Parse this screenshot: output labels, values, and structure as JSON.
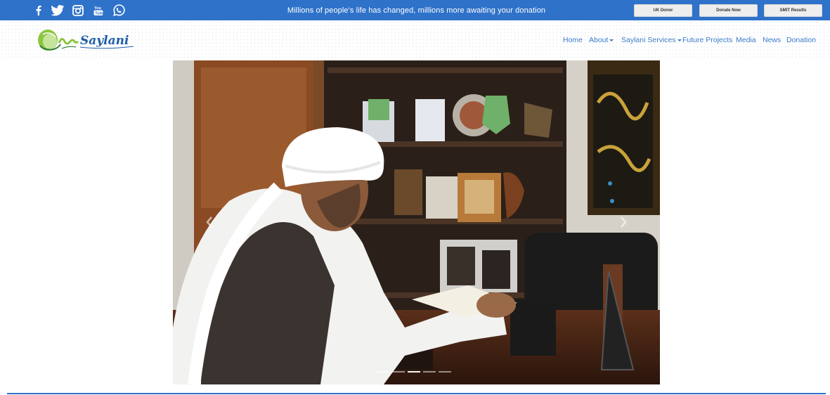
{
  "topbar": {
    "message": "Millions of people's life has changed, millions more awaiting your donation",
    "social": [
      "facebook-icon",
      "twitter-icon",
      "instagram-icon",
      "youtube-icon",
      "whatsapp-icon"
    ],
    "buttons": {
      "uk_donor": "UK Donor",
      "donate_now": "Donate Now",
      "smit_results": "SMIT Results"
    },
    "color": "#2f72c9"
  },
  "logo": {
    "text": "Saylani",
    "icon": "saylani-logo"
  },
  "nav": {
    "items": [
      {
        "label": "Home"
      },
      {
        "label": "About",
        "dropdown": true
      },
      {
        "label": "Saylani Services",
        "dropdown": true
      },
      {
        "label": "Future Projects"
      },
      {
        "label": "Media"
      },
      {
        "label": "News"
      },
      {
        "label": "Donation"
      }
    ],
    "link_color": "#3a7bc8"
  },
  "carousel": {
    "slide_count": 5,
    "active_index": 2,
    "prev_icon": "chevron-left-icon",
    "next_icon": "chevron-right-icon"
  }
}
